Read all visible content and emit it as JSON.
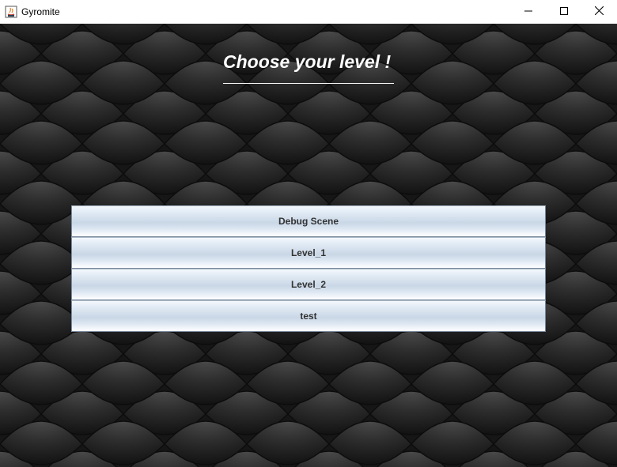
{
  "window": {
    "title": "Gyromite",
    "icon": "java-app-icon",
    "controls": [
      "minimize-icon",
      "maximize-icon",
      "close-icon"
    ]
  },
  "main": {
    "heading": "Choose your level !",
    "levels": [
      {
        "label": "Debug Scene"
      },
      {
        "label": "Level_1"
      },
      {
        "label": "Level_2"
      },
      {
        "label": "test"
      }
    ]
  },
  "colors": {
    "background": "#1c1c1c",
    "heading": "#ffffff",
    "button_text": "#333333",
    "button_border": "#7a8a9e"
  }
}
